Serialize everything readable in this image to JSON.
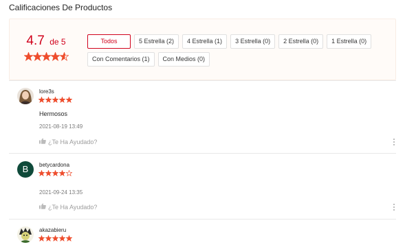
{
  "section_title": "Calificaciones De Productos",
  "summary": {
    "score": "4.7",
    "of_label": "de 5",
    "score_stars": [
      "full",
      "full",
      "full",
      "full",
      "half"
    ],
    "filters_row1": [
      "Todos",
      "5 Estrella (2)",
      "4 Estrella (1)",
      "3 Estrella (0)",
      "2 Estrella (0)",
      "1 Estrella (0)"
    ],
    "filters_row2": [
      "Con Comentarios (1)",
      "Con Medios (0)"
    ],
    "active_filter": "Todos"
  },
  "reviews": [
    {
      "author": "lore3s",
      "rating": 5,
      "content": "Hermosos",
      "date": "2021-08-19 13:49",
      "helpful_label": "¿Te Ha Ayudado?"
    },
    {
      "author": "betycardona",
      "avatar_letter": "B",
      "rating": 4,
      "content": "",
      "date": "2021-09-24 13:35",
      "helpful_label": "¿Te Ha Ayudado?"
    },
    {
      "author": "akazabieru",
      "rating": 5
    }
  ],
  "colors": {
    "accent": "#d0011b",
    "star": "#ee4d2d",
    "summary_bg": "#fffbf8"
  }
}
